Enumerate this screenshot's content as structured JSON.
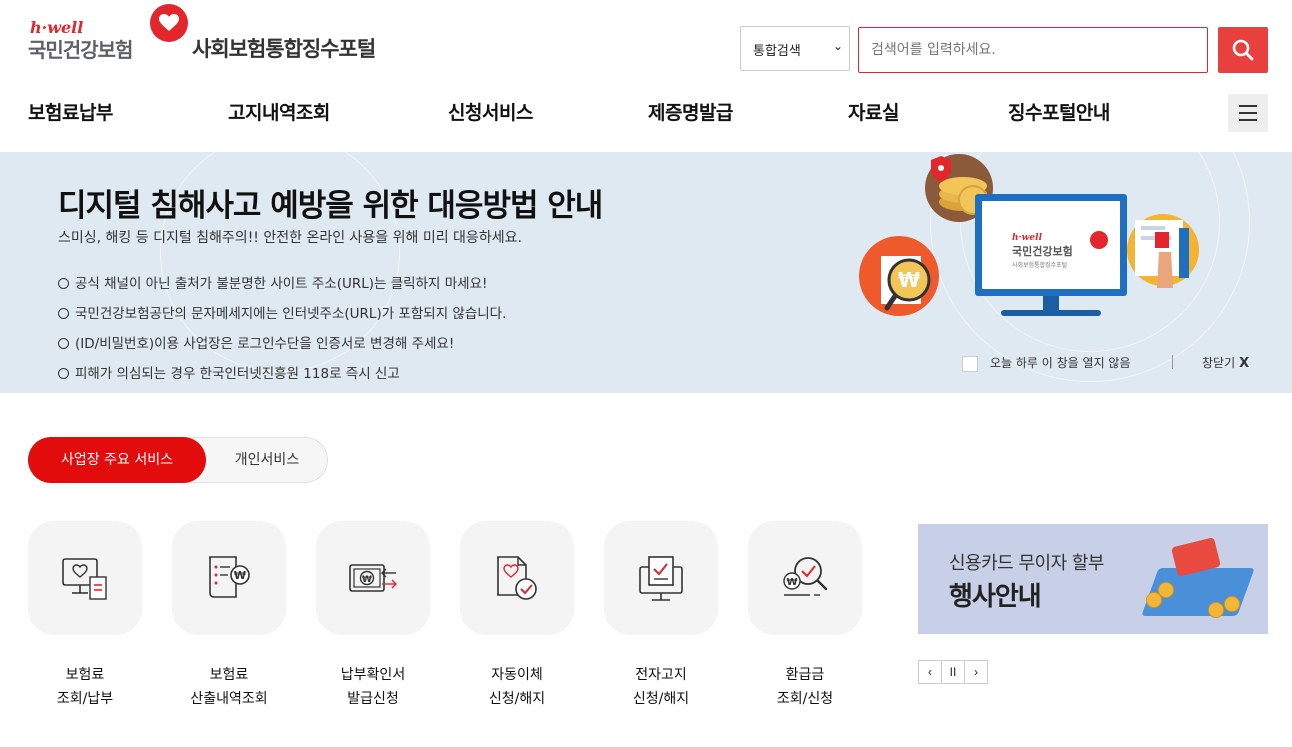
{
  "header": {
    "logo": {
      "hwell": "h·well",
      "org_name": "국민건강보험"
    },
    "portal_title": "사회보험통합징수포털",
    "search": {
      "scope_selected": "통합검색",
      "placeholder": "검색어를 입력하세요."
    }
  },
  "gnb": {
    "items": [
      {
        "label": "보험료납부"
      },
      {
        "label": "고지내역조회"
      },
      {
        "label": "신청서비스"
      },
      {
        "label": "제증명발급"
      },
      {
        "label": "자료실"
      },
      {
        "label": "징수포털안내"
      }
    ]
  },
  "banner": {
    "title": "디지털 침해사고 예방을 위한 대응방법 안내",
    "subtitle": "스미싱, 해킹 등 디지털 침해주의!! 안전한 온라인 사용을 위해 미리 대응하세요.",
    "bullets": [
      "공식 채널이 아닌 출처가 불분명한 사이트 주소(URL)는 클릭하지 마세요!",
      "국민건강보험공단의 문자메세지에는 인터넷주소(URL)가 포함되지 않습니다.",
      "(ID/비밀번호)이용 사업장은 로그인수단을 인증서로 변경해 주세요!",
      "피해가 의심되는 경우 한국인터넷진흥원 118로 즉시 신고"
    ],
    "illustration": {
      "screen_hwell": "h·well",
      "screen_org": "국민건강보험",
      "screen_portal": "사회보험통합징수포털"
    },
    "dont_show_today": "오늘 하루 이 창을 열지 않음",
    "close_label": "창닫기",
    "close_x": "X"
  },
  "tabs": {
    "active": "사업장 주요 서비스",
    "inactive": "개인서비스"
  },
  "services": [
    {
      "line1": "보험료",
      "line2": "조회/납부",
      "icon": "monitor-heart-receipt-icon"
    },
    {
      "line1": "보험료",
      "line2": "산출내역조회",
      "icon": "document-won-icon"
    },
    {
      "line1": "납부확인서",
      "line2": "발급신청",
      "icon": "wallet-won-arrows-icon"
    },
    {
      "line1": "자동이체",
      "line2": "신청/해지",
      "icon": "document-heart-check-icon"
    },
    {
      "line1": "전자고지",
      "line2": "신청/해지",
      "icon": "monitor-document-check-icon"
    },
    {
      "line1": "환급금",
      "line2": "조회/신청",
      "icon": "magnifier-won-check-icon"
    }
  ],
  "promo": {
    "line1": "신용카드 무이자 할부",
    "line2": "행사안내"
  },
  "slider_controls": {
    "prev": "‹",
    "pause": "II",
    "next": "›"
  },
  "colors": {
    "brand_red": "#e2262b",
    "banner_bg": "#dfe9f2",
    "tab_active": "#e20c0c",
    "promo_bg": "#c7d0e6"
  }
}
